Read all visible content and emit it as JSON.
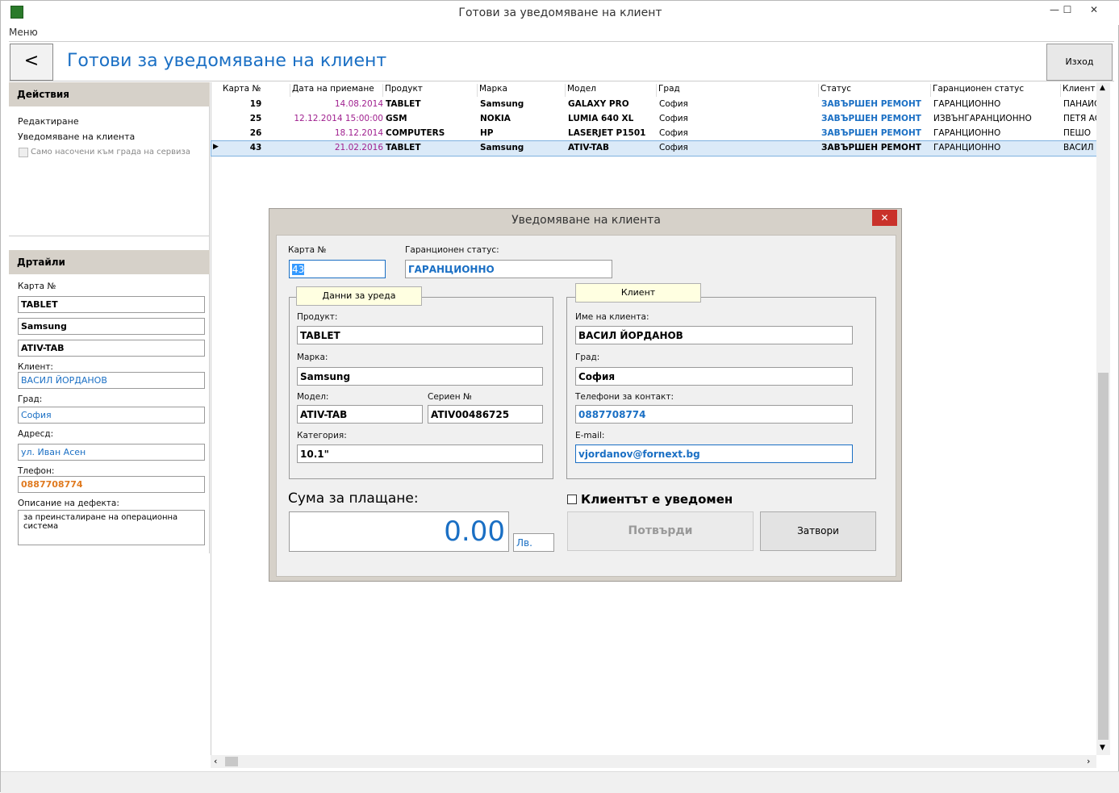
{
  "window": {
    "title": "Готови за уведомяване на клиент",
    "menu": "Меню",
    "min": "—",
    "max": "☐",
    "close": "✕"
  },
  "header": {
    "back": "<",
    "title": "Готови за уведомяване на клиент",
    "exit": "Изход"
  },
  "actions": {
    "heading": "Действия",
    "edit": "Редактиране",
    "notify": "Уведомяване на клиента",
    "only_city": "Само насочени към града на сервиза"
  },
  "details": {
    "heading": "Дртайли",
    "card_label": "Карта №",
    "product": "TABLET",
    "brand": "Samsung",
    "model": "ATIV-TAB",
    "client_label": "Клиент:",
    "client": "ВАСИЛ ЙОРДАНОВ",
    "city_label": "Град:",
    "city": "София",
    "address_label": "Адресд:",
    "address": "ул. Иван Асен",
    "phone_label": "Тлефон:",
    "phone": "0887708774",
    "defect_label": "Описание на дефекта:",
    "defect": "за преинсталиране на операционна система"
  },
  "grid": {
    "columns": [
      "Карта №",
      "Дата на приемане",
      "Продукт",
      "Марка",
      "Модел",
      "Град",
      "Статус",
      "Гаранционен статус",
      "Клиент"
    ],
    "rows": [
      [
        "19",
        "14.08.2014",
        "TABLET",
        "Samsung",
        "GALAXY PRO",
        "София",
        "ЗАВЪРШЕН РЕМОНТ",
        "ГАРАНЦИОННО",
        "ПАНАЙС"
      ],
      [
        "25",
        "12.12.2014 15:00:00",
        "GSM",
        "NOKIA",
        "LUMIA 640 XL",
        "София",
        "ЗАВЪРШЕН РЕМОНТ",
        "ИЗВЪНГАРАНЦИОННО",
        "ПЕТЯ АС"
      ],
      [
        "26",
        "18.12.2014",
        "COMPUTERS",
        "HP",
        "LASERJET P1501",
        "София",
        "ЗАВЪРШЕН РЕМОНТ",
        "ГАРАНЦИОННО",
        "ПЕШО"
      ],
      [
        "43",
        "21.02.2016",
        "TABLET",
        "Samsung",
        "ATIV-TAB",
        "София",
        "ЗАВЪРШЕН РЕМОНТ",
        "ГАРАНЦИОННО",
        "ВАСИЛ Й"
      ]
    ],
    "selected_row": 3
  },
  "dialog": {
    "title": "Уведомяване на клиента",
    "close": "✕",
    "card_label": "Карта №",
    "card": "43",
    "warranty_label": "Гаранционен статус:",
    "warranty": "ГАРАНЦИОННО",
    "device_tab": "Данни за уреда",
    "client_tab": "Клиент",
    "product_label": "Продукт:",
    "product": "TABLET",
    "brand_label": "Марка:",
    "brand": "Samsung",
    "model_label": "Модел:",
    "model": "ATIV-TAB",
    "serial_label": "Сериен №",
    "serial": "ATIV00486725",
    "category_label": "Категория:",
    "category": "10.1\"",
    "client_name_label": "Име на клиента:",
    "client_name": "ВАСИЛ ЙОРДАНОВ",
    "city_label": "Град:",
    "city": "София",
    "phones_label": "Телефони за контакт:",
    "phones": "0887708774",
    "email_label": "E-mail:",
    "email": "vjordanov@fornext.bg",
    "sum_label": "Сума за плащане:",
    "sum": "0.00",
    "currency": "Лв.",
    "notified_label": "Клиентът е уведомен",
    "confirm": "Потвърди",
    "close_btn": "Затвори"
  },
  "colors": {
    "accent": "#1a6fc4",
    "date": "#a0208f",
    "phone": "#e07a1f",
    "panel": "#d6d1c9"
  }
}
